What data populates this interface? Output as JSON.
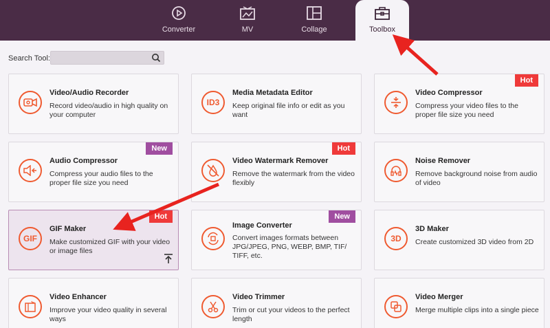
{
  "tabs": [
    {
      "label": "Converter",
      "icon": "converter-icon"
    },
    {
      "label": "MV",
      "icon": "mv-icon"
    },
    {
      "label": "Collage",
      "icon": "collage-icon"
    },
    {
      "label": "Toolbox",
      "icon": "toolbox-icon",
      "active": true
    }
  ],
  "search": {
    "label": "Search Tool:",
    "placeholder": ""
  },
  "colors": {
    "accent": "#ef5a30",
    "hot": "#ef3a3a",
    "new": "#a04ea0",
    "topbar": "#4a2c46"
  },
  "tools": [
    {
      "title": "Video/Audio Recorder",
      "desc": "Record video/audio in high quality on your computer",
      "icon": "recorder-icon",
      "badge": ""
    },
    {
      "title": "Media Metadata Editor",
      "desc": "Keep original file info or edit as you want",
      "icon": "id3-icon",
      "icon_text": "ID3",
      "badge": ""
    },
    {
      "title": "Video Compressor",
      "desc": "Compress your video files to the proper file size you need",
      "icon": "compress-icon",
      "badge": "Hot"
    },
    {
      "title": "Audio Compressor",
      "desc": "Compress your audio files to the proper file size you need",
      "icon": "audio-compress-icon",
      "badge": "New"
    },
    {
      "title": "Video Watermark Remover",
      "desc": "Remove the watermark from the video flexibly",
      "icon": "watermark-icon",
      "badge": "Hot"
    },
    {
      "title": "Noise Remover",
      "desc": "Remove background noise from audio of video",
      "icon": "noise-icon",
      "badge": ""
    },
    {
      "title": "GIF Maker",
      "desc": "Make customized GIF with your video or image files",
      "icon": "gif-icon",
      "icon_text": "GIF",
      "badge": "Hot"
    },
    {
      "title": "Image Converter",
      "desc": "Convert images formats between JPG/JPEG, PNG, WEBP, BMP, TIF/ TIFF, etc.",
      "icon": "image-convert-icon",
      "badge": "New"
    },
    {
      "title": "3D Maker",
      "desc": "Create customized 3D video from 2D",
      "icon": "3d-icon",
      "icon_text": "3D",
      "badge": ""
    },
    {
      "title": "Video Enhancer",
      "desc": "Improve your video quality in several ways",
      "icon": "enhancer-icon",
      "badge": ""
    },
    {
      "title": "Video Trimmer",
      "desc": "Trim or cut your videos to the perfect length",
      "icon": "scissors-icon",
      "badge": ""
    },
    {
      "title": "Video Merger",
      "desc": "Merge multiple clips into a single piece",
      "icon": "merge-icon",
      "badge": ""
    }
  ]
}
